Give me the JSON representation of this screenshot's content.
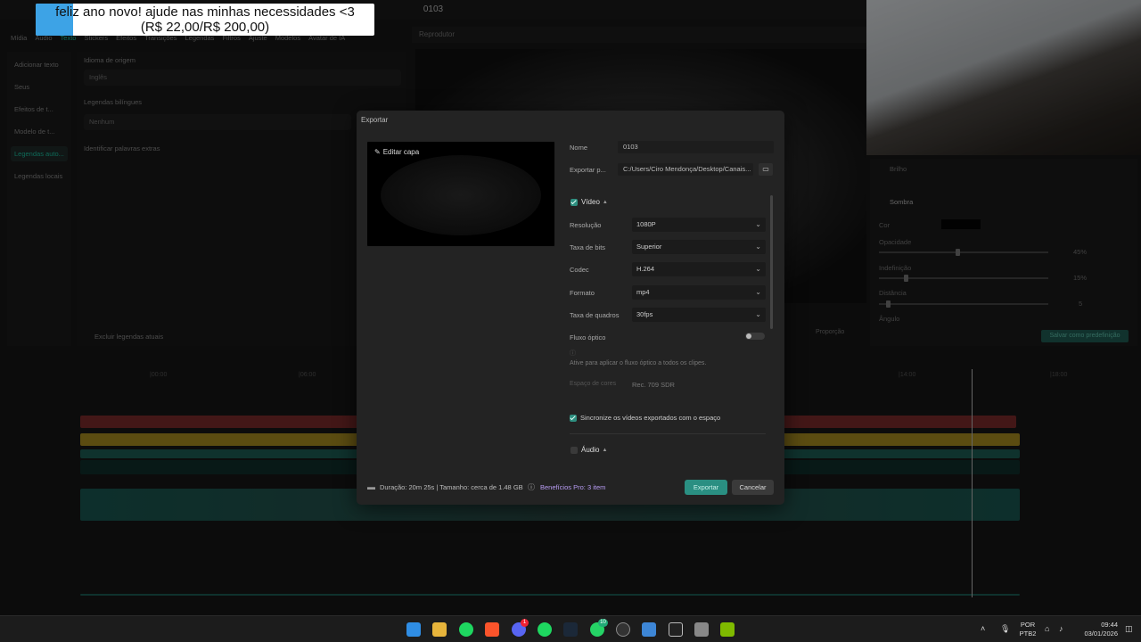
{
  "window": {
    "title": "0103"
  },
  "donation": {
    "line1": "feliz ano novo! ajude nas minhas necessidades <3",
    "line2": "(R$ 22,00/R$ 200,00)",
    "progress_fraction": 0.11
  },
  "top_menu": [
    "Mídia",
    "Áudio",
    "Texto",
    "Stickers",
    "Efeitos",
    "Transições",
    "Legendas",
    "Filtros",
    "Ajuste",
    "Modelos",
    "Avatar de IA"
  ],
  "left_nav": [
    "Adicionar texto",
    "Seus",
    "Efeitos de t...",
    "Modelo de t...",
    "Legendas auto...",
    "Legendas locais"
  ],
  "left_content": {
    "idioma_label": "Idioma de origem",
    "idioma_value": "Inglês",
    "bilingue_label": "Legendas bilíngues",
    "bilingue_value": "Nenhum",
    "extras_label": "Identificar palavras extras",
    "excluir_label": "Excluir legendas atuais"
  },
  "player": {
    "header": "Reprodutor",
    "proportion": "Proporção"
  },
  "right_panel": {
    "brilho": "Brilho",
    "sombra": "Sombra",
    "cor": "Cor",
    "opacidade": "Opacidade",
    "opacidade_val": "45%",
    "indefinicao": "Indefinição",
    "indefinicao_val": "15%",
    "distancia": "Distância",
    "distancia_val": "5",
    "angulo": "Ângulo",
    "save_preset": "Salvar como predefinição"
  },
  "timeline": {
    "ruler": [
      "|00:00",
      "|06:00",
      "|14:00",
      "|18:00"
    ]
  },
  "modal": {
    "title": "Exportar",
    "edit_cover": "Editar capa",
    "name_label": "Nome",
    "name_value": "0103",
    "export_path_label": "Exportar p...",
    "export_path_value": "C:/Users/Ciro Mendonça/Desktop/Canais...",
    "video_label": "Vídeo",
    "resolution_label": "Resolução",
    "resolution_value": "1080P",
    "bitrate_label": "Taxa de bits",
    "bitrate_value": "Superior",
    "codec_label": "Codec",
    "codec_value": "H.264",
    "format_label": "Formato",
    "format_value": "mp4",
    "framerate_label": "Taxa de quadros",
    "framerate_value": "30fps",
    "optical_flow_label": "Fluxo óptico",
    "optical_flow_desc": "Ative para aplicar o fluxo óptico a todos os clipes.",
    "color_space_label": "Espaço de cores",
    "color_space_value": "Rec. 709 SDR",
    "sync_label": "Sincronize os vídeos exportados com o espaço",
    "audio_label": "Áudio",
    "duration_info": "Duração: 20m 25s | Tamanho: cerca de 1.48 GB",
    "pro_benefits": "Benefícios Pro: 3 item",
    "export_button": "Exportar",
    "cancel_button": "Cancelar"
  },
  "taskbar": {
    "language_line1": "POR",
    "language_line2": "PTB2",
    "time": "09:44",
    "date": "03/01/2026",
    "discord_badge": "1",
    "whatsapp_badge": "10"
  },
  "colors": {
    "accent": "#2a8f82",
    "modal_bg": "#232323",
    "app_bg": "#161616"
  }
}
